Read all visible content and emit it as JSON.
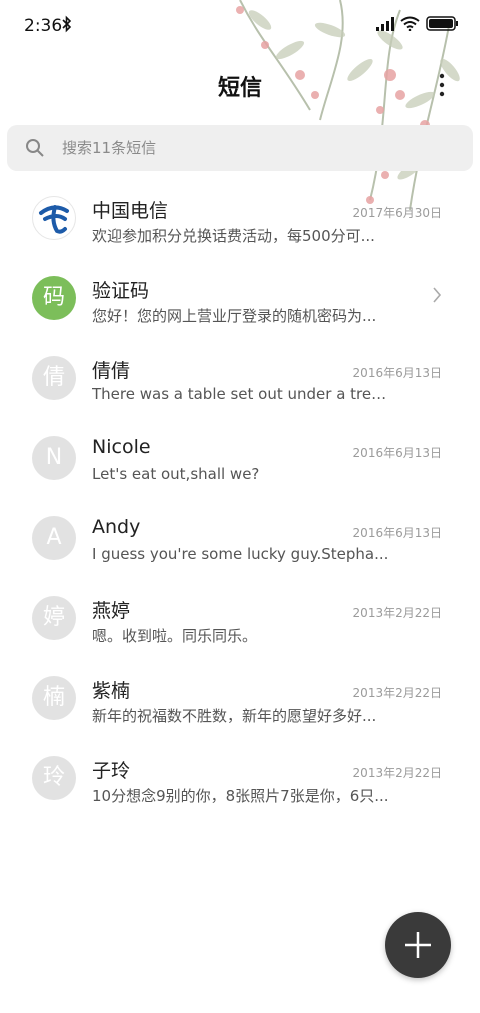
{
  "status": {
    "time": "2:36"
  },
  "header": {
    "title": "短信"
  },
  "search": {
    "placeholder": "搜索11条短信"
  },
  "threads": [
    {
      "avatar": "",
      "avatar_type": "logo",
      "name": "中国电信",
      "preview": "欢迎参加积分兑换话费活动，每500分可...",
      "date": "2017年6月30日"
    },
    {
      "avatar": "码",
      "avatar_type": "green",
      "name": "验证码",
      "preview": "您好！您的网上营业厅登录的随机密码为...",
      "date": ""
    },
    {
      "avatar": "倩",
      "avatar_type": "gray",
      "name": "倩倩",
      "preview": "There was a table set out under a tree i...",
      "date": "2016年6月13日"
    },
    {
      "avatar": "N",
      "avatar_type": "gray",
      "name": "Nicole",
      "preview": "Let's eat out,shall we?",
      "date": "2016年6月13日"
    },
    {
      "avatar": "A",
      "avatar_type": "gray",
      "name": "Andy",
      "preview": "I guess you're some lucky guy.Stepha...",
      "date": "2016年6月13日"
    },
    {
      "avatar": "婷",
      "avatar_type": "gray",
      "name": "燕婷",
      "preview": "嗯。收到啦。同乐同乐。",
      "date": "2013年2月22日"
    },
    {
      "avatar": "楠",
      "avatar_type": "gray",
      "name": "紫楠",
      "preview": "新年的祝福数不胜数，新年的愿望好多好...",
      "date": "2013年2月22日"
    },
    {
      "avatar": "玲",
      "avatar_type": "gray",
      "name": "子玲",
      "preview": "10分想念9别的你，8张照片7张是你，6只...",
      "date": "2013年2月22日"
    }
  ],
  "colors": {
    "fab": "#3a3a3a",
    "green_avatar": "#7cbe5a",
    "gray_avatar": "#e2e2e2",
    "telecom_blue": "#1d5ba9"
  }
}
